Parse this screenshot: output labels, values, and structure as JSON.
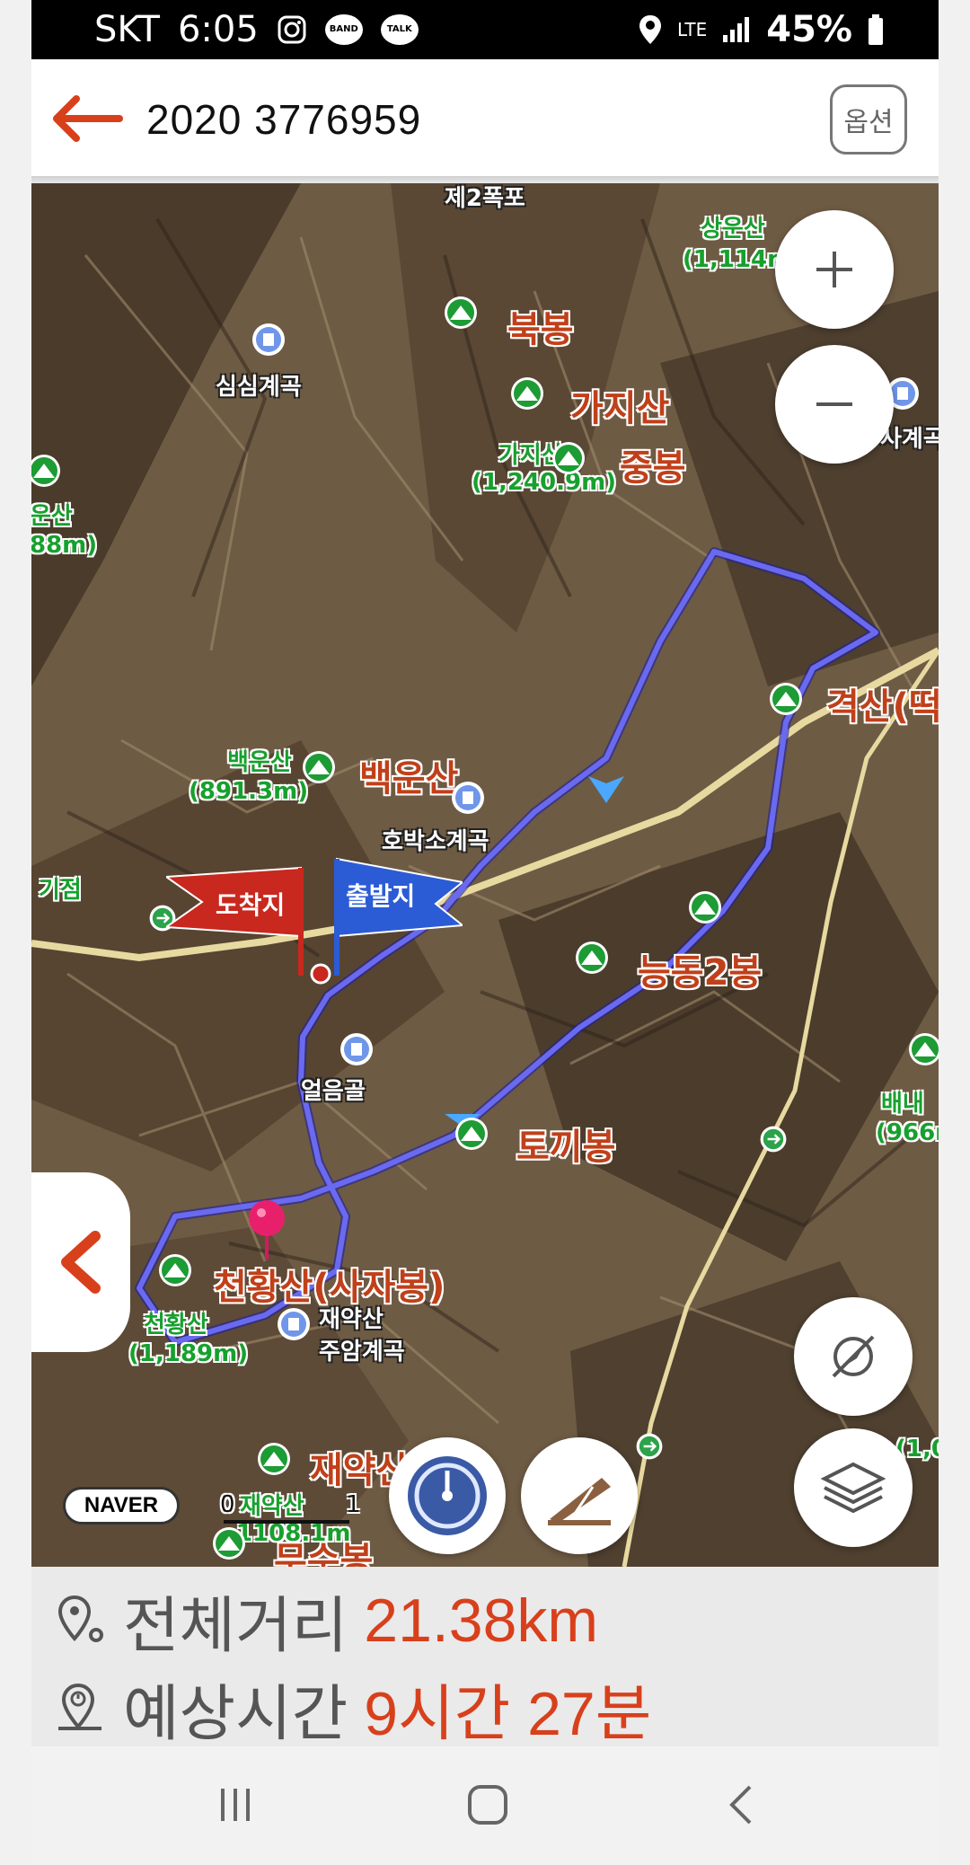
{
  "status": {
    "carrier": "SKT",
    "time": "6:05",
    "network": "LTE",
    "battery": "45%",
    "icons": [
      "instagram-icon",
      "band-icon",
      "talk-icon",
      "location-icon",
      "signal-icon",
      "battery-icon"
    ],
    "band": "BAND",
    "talk": "TALK"
  },
  "header": {
    "title": "2020 3776959",
    "options_label": "옵션"
  },
  "map": {
    "labels": {
      "l1": "제2폭포",
      "l2": "상운산",
      "l3": "(1,114m",
      "l4": "북봉",
      "l5": "심심계곡",
      "l6": "가지산",
      "l7": "가지산",
      "l8": "(1,240.9m)",
      "l9": "중봉",
      "l10": "사계곡",
      "l11": "운산",
      "l12": "88m)",
      "l13": "격산(떡",
      "l14": "백운산",
      "l15": "(891.3m)",
      "l16": "백운산",
      "l17": "호박소계곡",
      "l18": "기점",
      "l19": "능동2봉",
      "l20": "얼음골",
      "l21": "배내",
      "l22": "(966m",
      "l23": "토끼봉",
      "l24": "천황산(사자봉)",
      "l25": "천황산",
      "l26": "(1,189m)",
      "l27": "재약산",
      "l28": "주암계곡",
      "l29": "재약산 미봉",
      "l30": "재약산",
      "l31": "(1,0",
      "l32": "무수봉",
      "l33": "1108.1m"
    },
    "flags": {
      "arrival": "도착지",
      "departure": "출발지"
    },
    "watermark": "NAVER",
    "scale": {
      "zero": "0",
      "one": "1"
    },
    "colors": {
      "route": "#5b5be8",
      "road": "#e8d9a0",
      "accent": "#d8401c",
      "peak_green": "#17a02e"
    }
  },
  "summary": {
    "distance_label": "전체거리",
    "distance_value": "21.38km",
    "time_label": "예상시간",
    "time_value": "9시간 27분"
  },
  "nav": {
    "buttons": [
      "recent-apps",
      "home",
      "back"
    ]
  }
}
